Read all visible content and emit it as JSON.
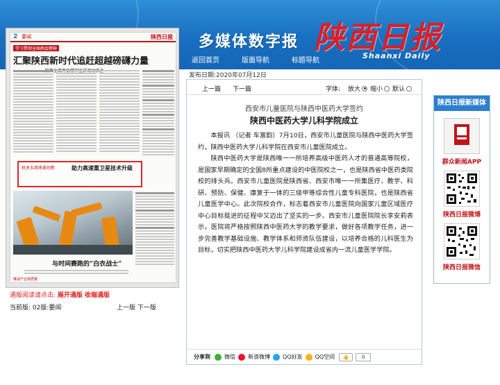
{
  "header": {
    "multimedia_title": "多媒体数字报",
    "logo_text": "陕西日报",
    "logo_en": "Shaanxi Daily",
    "nav": [
      "返回首页",
      "版面导航",
      "标题导航"
    ]
  },
  "newspaper_page": {
    "page_number": "2",
    "section": "要闻",
    "masthead": "陕西日报",
    "kicker": "学习贯彻全国两会精神",
    "headline": "汇聚陕西新时代追赶超越磅礴力量",
    "subhead": "——陕西全面两会精神宣讲活动综述",
    "box_title": "机关五项改革创新",
    "box_headline": "助力高速重卫星技术升级",
    "photo_headline": "与时间赛跑的“白衣战士”",
    "footer_label": "推进产业高质量"
  },
  "edition": {
    "prompt": "通版阅读请点击:",
    "expand": "展开通版",
    "collapse": "收缩通版",
    "current_label": "当前版:",
    "current_value": "02版:要闻",
    "prev_page": "上一版",
    "next_page": "下一版"
  },
  "article": {
    "pub_date_label": "发布日期:",
    "pub_date": "2020年07月12日",
    "prev": "上一篇",
    "next": "下一篇",
    "font_label": "字体:",
    "font_options": [
      "放大",
      "缩小",
      "默认"
    ],
    "pre_title": "西安市儿童医院与陕西中医药大学签约",
    "title": "陕西中医药大学儿科学院成立",
    "paragraphs": [
      "本报讯 （记者 车富韵）7月10日，西安市儿童医院与陕西中医药大学签约，陕西中医药大学儿科学院在西安市儿童医院成立。",
      "陕西中医药大学是陕西唯一一所培养高级中医药人才的普通高等院校，是国家早期确定的全国8所重点建设的中医院校之一，也是陕西省中医药类院校的排头兵。西安市儿童医院是陕西省、西安市唯一一所集医疗、教学、科研、预防、保健、康复于一体的三级甲等综合性儿童专科医院，也是陕西省儿童医学中心。此次院校合作，标志着西安市儿童医院向国家儿童区域医疗中心目标挺进的征程中又迈出了坚实的一步。西安市儿童医院院长李安莉表示，医院将严格按照陕西中医药大学的教学要求，做好各项教学任务，进一步完善教学基础设施、教学体系和师资队伍建设，以培养合格的儿科医生为目标，切实把陕西中医药大学儿科学院建设成省内一流儿童医学学院。"
    ],
    "share_label": "分享到",
    "share_items": [
      "微信",
      "新浪微博",
      "QQ好友",
      "QQ空间"
    ],
    "like_count": "0"
  },
  "sidebar": {
    "title": "陕西日报新媒体",
    "qr_labels": [
      "群众新闻APP",
      "陕西日报微博",
      "陕西日报微信"
    ]
  }
}
